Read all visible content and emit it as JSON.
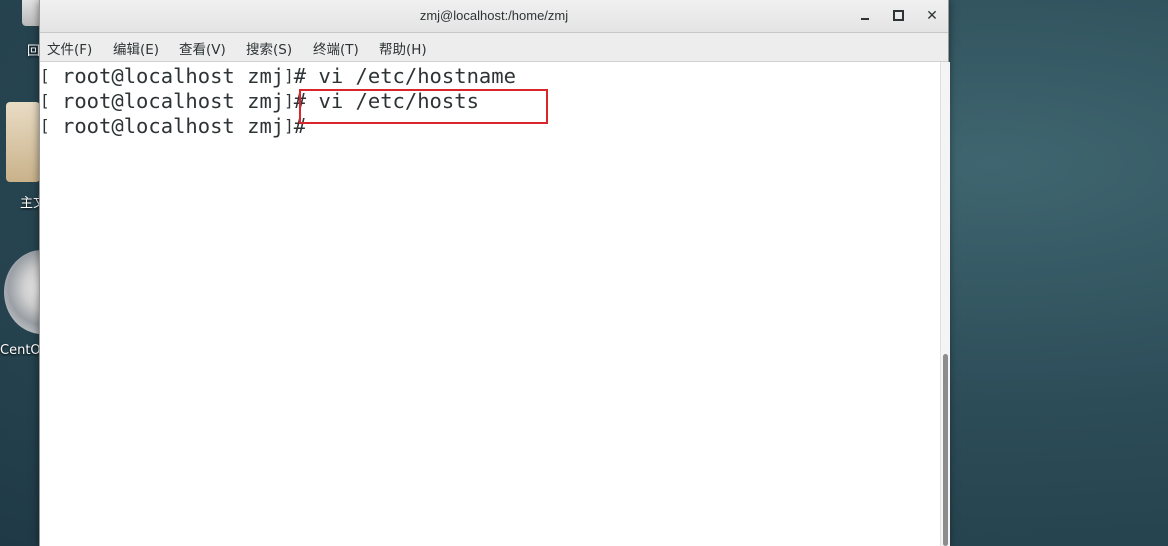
{
  "desktop": {
    "icons": [
      {
        "label": "回"
      },
      {
        "label": "主文"
      },
      {
        "label": "CentOS"
      }
    ]
  },
  "window": {
    "title": "zmj@localhost:/home/zmj",
    "controls": {
      "minimize": "minimize",
      "maximize": "maximize",
      "close": "✕"
    }
  },
  "menu": [
    {
      "label": "文件(F)"
    },
    {
      "label": "编辑(E)"
    },
    {
      "label": "查看(V)"
    },
    {
      "label": "搜索(S)"
    },
    {
      "label": "终端(T)"
    },
    {
      "label": "帮助(H)"
    }
  ],
  "terminal": {
    "lines": [
      {
        "open": "[",
        "prompt": "root@localhost zmj",
        "close": "]",
        "command": "# vi /etc/hostname"
      },
      {
        "open": "[",
        "prompt": "root@localhost zmj",
        "close": "]",
        "command": "# vi /etc/hosts"
      },
      {
        "open": "[",
        "prompt": "root@localhost zmj",
        "close": "]",
        "command": "#"
      }
    ],
    "highlight_color": "#d9262a"
  },
  "scrollbar": {
    "position": 1.0
  }
}
